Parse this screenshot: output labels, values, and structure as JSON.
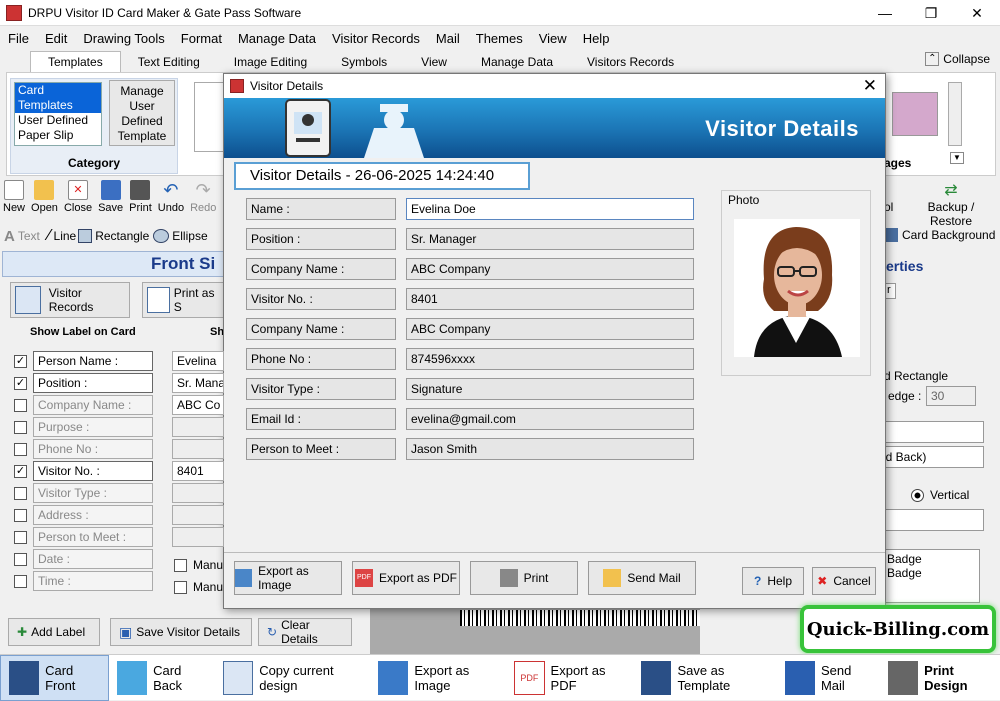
{
  "app": {
    "title": "DRPU Visitor ID Card Maker & Gate Pass Software"
  },
  "menu": [
    "File",
    "Edit",
    "Drawing Tools",
    "Format",
    "Manage Data",
    "Visitor Records",
    "Mail",
    "Themes",
    "View",
    "Help"
  ],
  "ribbon_tabs": [
    "Templates",
    "Text Editing",
    "Symbols",
    "View",
    "Manage Data",
    "Visitors Records"
  ],
  "ribbon_tab_image_editing": "Image Editing",
  "collapse_label": "Collapse",
  "category": {
    "items": [
      "Card Templates",
      "User Defined",
      "Paper Slip"
    ],
    "manage_udt": "Manage User Defined Template",
    "label": "Category"
  },
  "images_group_label": "ages",
  "toolbar": {
    "new": "New",
    "open": "Open",
    "close": "Close",
    "save": "Save",
    "print": "Print",
    "undo": "Undo",
    "redo": "Redo",
    "tol": "ol",
    "backup": "Backup / Restore"
  },
  "drawing": {
    "text": "Text",
    "line": "Line",
    "rectangle": "Rectangle",
    "ellipse": "Ellipse",
    "card_background": "Card Background"
  },
  "panel": {
    "front_side": "Front Si",
    "visitor_records": "Visitor Records",
    "print_as": "Print as S",
    "show_label": "Show Label on Card",
    "show_value": "Sh",
    "labels": [
      {
        "text": "Person Name :",
        "checked": true,
        "value": "Evelina"
      },
      {
        "text": "Position :",
        "checked": true,
        "value": "Sr. Mana"
      },
      {
        "text": "Company Name :",
        "checked": false,
        "value": "ABC Co"
      },
      {
        "text": "Purpose :",
        "checked": false,
        "value": ""
      },
      {
        "text": "Phone No :",
        "checked": false,
        "value": ""
      },
      {
        "text": "Visitor No. :",
        "checked": true,
        "value": "8401"
      },
      {
        "text": "Visitor Type :",
        "checked": false,
        "value": ""
      },
      {
        "text": "Address :",
        "checked": false,
        "value": ""
      },
      {
        "text": "Person to Meet :",
        "checked": false,
        "value": ""
      },
      {
        "text": "Date :",
        "checked": false,
        "value": ""
      },
      {
        "text": "Time :",
        "checked": false,
        "value": ""
      }
    ],
    "manual1": "Manu",
    "manual2": "Manu",
    "add_label": "Add Label",
    "save_visitor_details": "Save Visitor Details",
    "clear_details": "Clear Details"
  },
  "right_panel": {
    "properties": "erties",
    "r": "r",
    "rounded_rect": "d Rectangle",
    "edge_label": "edge :",
    "edge_value": "30",
    "front_back": "nd Back)",
    "vertical": "Vertical",
    "list": [
      "Badge",
      "Badge"
    ]
  },
  "dialog": {
    "title": "Visitor Details",
    "banner_title": "Visitor Details",
    "heading": "Visitor Details - 26-06-2025 14:24:40",
    "photo_label": "Photo",
    "fields": [
      {
        "label": "Name :",
        "value": "Evelina Doe"
      },
      {
        "label": "Position :",
        "value": "Sr. Manager"
      },
      {
        "label": "Company Name :",
        "value": "ABC Company"
      },
      {
        "label": "Visitor No. :",
        "value": "8401"
      },
      {
        "label": "Company Name :",
        "value": "ABC Company"
      },
      {
        "label": "Phone No :",
        "value": "874596xxxx"
      },
      {
        "label": "Visitor Type :",
        "value": "Signature"
      },
      {
        "label": "Email Id :",
        "value": "evelina@gmail.com"
      },
      {
        "label": "Person to Meet :",
        "value": "Jason Smith"
      }
    ],
    "buttons": {
      "export_image": "Export as Image",
      "export_pdf": "Export as PDF",
      "print": "Print",
      "send_mail": "Send Mail",
      "help": "Help",
      "cancel": "Cancel"
    }
  },
  "bottom_bar": {
    "card_front": "Card Front",
    "card_back": "Card Back",
    "copy_design": "Copy current design",
    "export_image": "Export as Image",
    "export_pdf": "Export as PDF",
    "save_template": "Save as Template",
    "send_mail": "Send Mail",
    "print_design": "Print Design"
  },
  "watermark": "Quick-Billing.com",
  "colors": {
    "accent": "#0a64d8",
    "banner": "#1b74b4",
    "watermark_border": "#38c33a"
  }
}
